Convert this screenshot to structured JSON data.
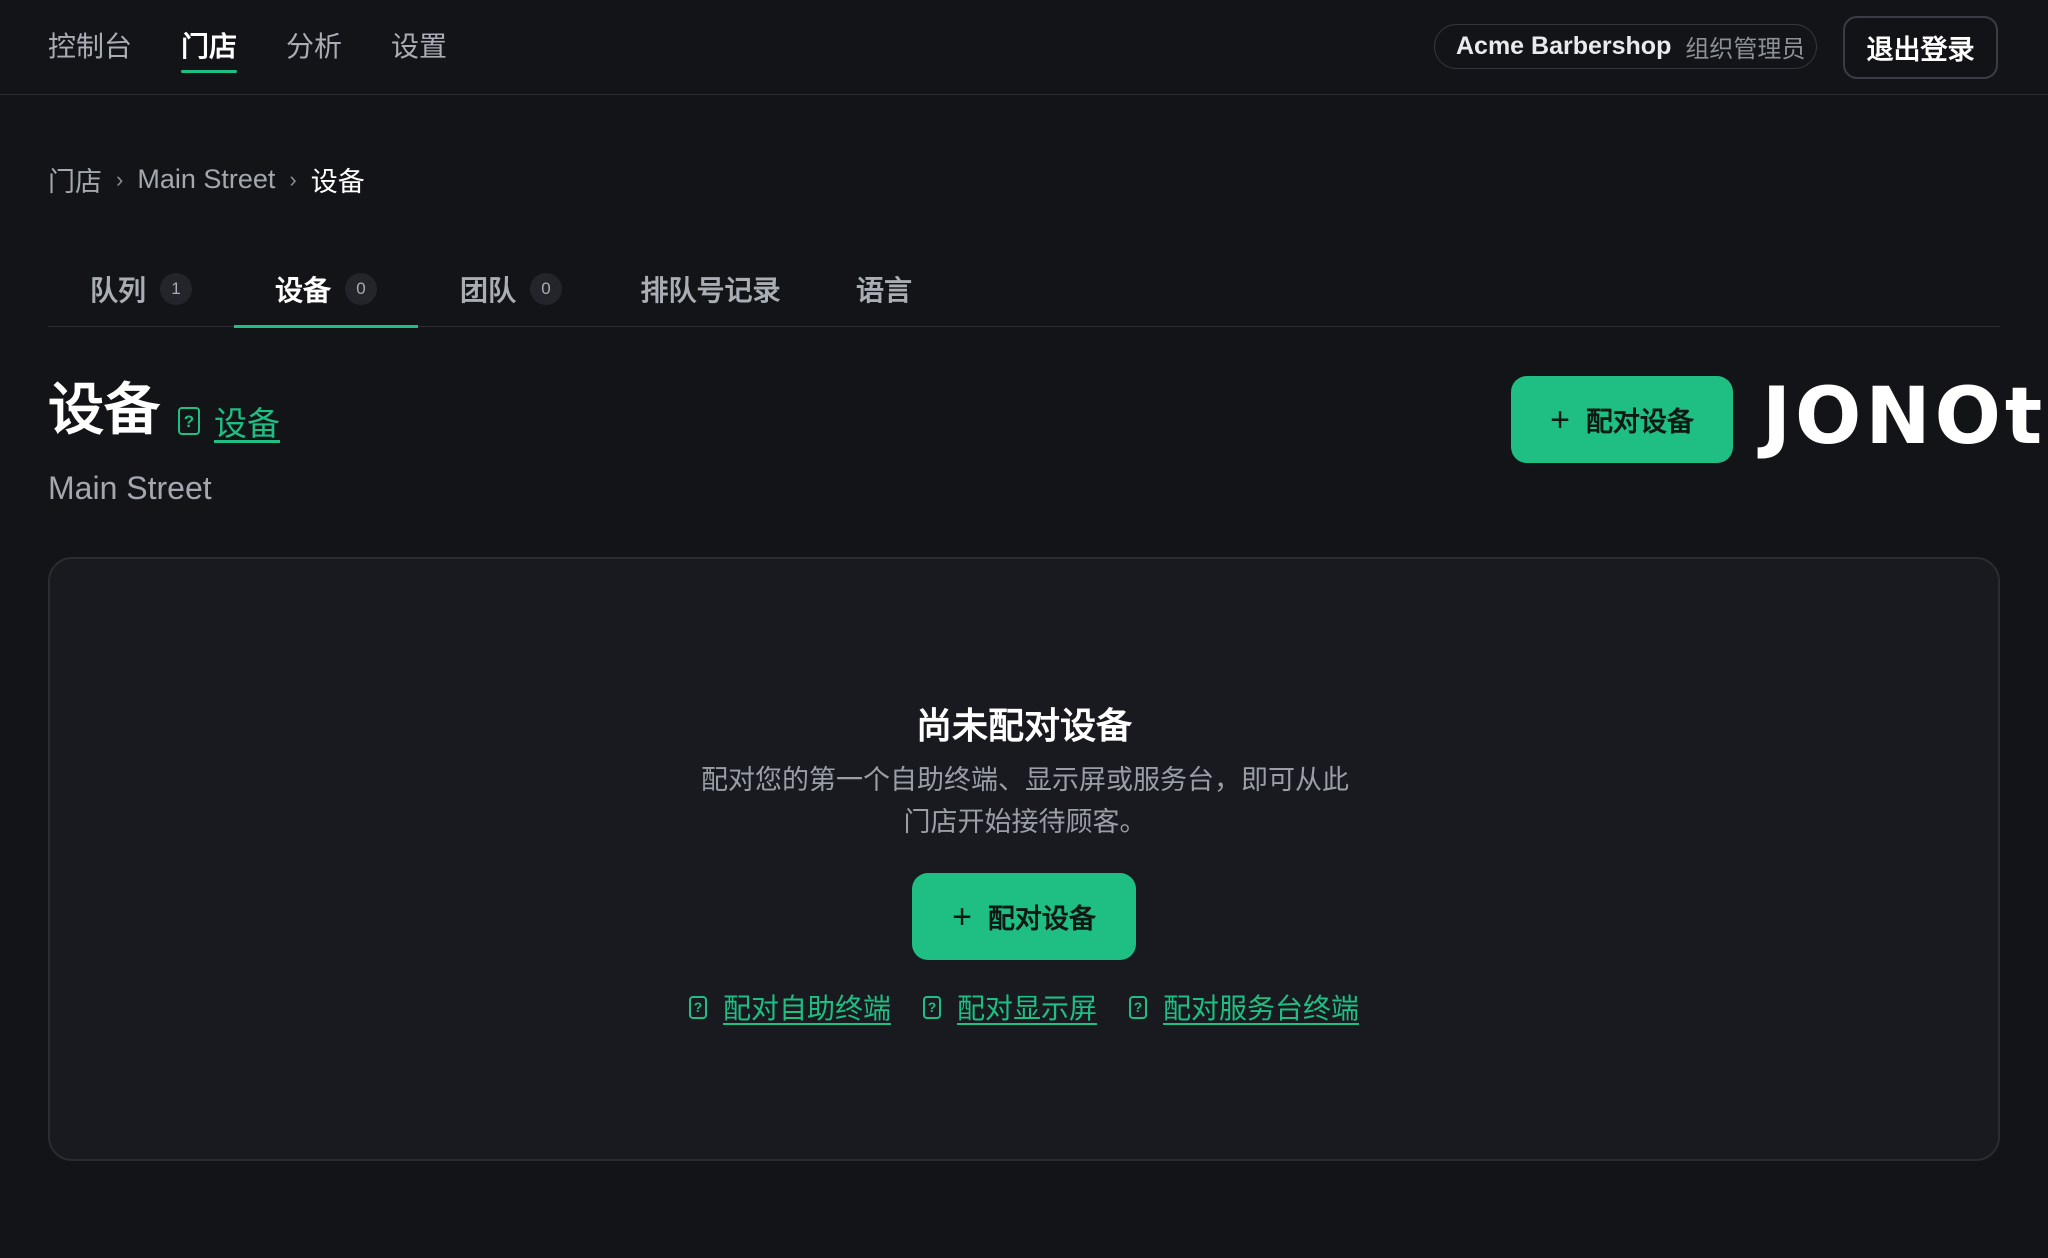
{
  "nav": {
    "items": [
      {
        "label": "控制台",
        "active": false
      },
      {
        "label": "门店",
        "active": true
      },
      {
        "label": "分析",
        "active": false
      },
      {
        "label": "设置",
        "active": false
      }
    ]
  },
  "org": {
    "name": "Acme Barbershop",
    "role": "组织管理员"
  },
  "logout_label": "退出登录",
  "breadcrumb": {
    "root": "门店",
    "location": "Main Street",
    "current": "设备",
    "separator": "›"
  },
  "tabs": [
    {
      "label": "队列",
      "count": "1"
    },
    {
      "label": "设备",
      "count": "0",
      "active": true
    },
    {
      "label": "团队",
      "count": "0"
    },
    {
      "label": "排队号记录"
    },
    {
      "label": "语言"
    }
  ],
  "header": {
    "title": "设备",
    "help_link": "设备",
    "subtitle": "Main Street",
    "pair_button": "配对设备",
    "brand": "JONOt"
  },
  "empty_state": {
    "title": "尚未配对设备",
    "description": "配对您的第一个自助终端、显示屏或服务台，即可从此门店开始接待顾客。",
    "button": "配对设备",
    "links": [
      "配对自助终端",
      "配对显示屏",
      "配对服务台终端"
    ]
  },
  "icons": {
    "plus": "plus-icon",
    "doc": "help-doc-icon"
  },
  "colors": {
    "accent": "#1fbf83",
    "background": "#131418",
    "card": "#181a1f"
  }
}
